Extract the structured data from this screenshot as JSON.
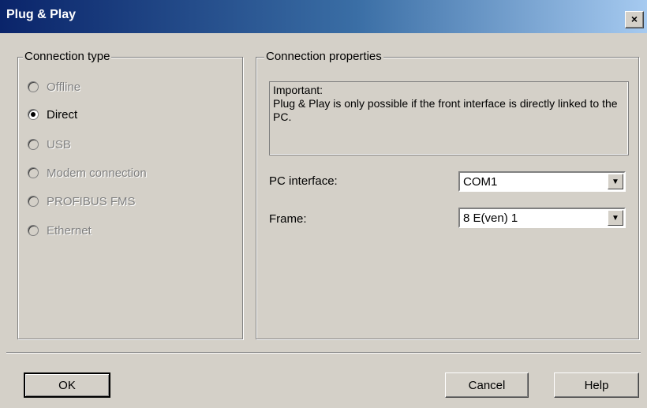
{
  "window": {
    "title": "Plug & Play",
    "close_glyph": "×"
  },
  "connection_type": {
    "legend": "Connection type",
    "options": [
      {
        "label": "Offline",
        "checked": false,
        "enabled": false
      },
      {
        "label": "Direct",
        "checked": true,
        "enabled": true
      },
      {
        "label": "USB",
        "checked": false,
        "enabled": false
      },
      {
        "label": "Modem connection",
        "checked": false,
        "enabled": false
      },
      {
        "label": "PROFIBUS FMS",
        "checked": false,
        "enabled": false
      },
      {
        "label": "Ethernet",
        "checked": false,
        "enabled": false
      }
    ]
  },
  "connection_properties": {
    "legend": "Connection properties",
    "info_line1": "Important:",
    "info_line2": "Plug & Play is only possible if the front interface is directly linked to the PC.",
    "pc_interface": {
      "label": "PC interface:",
      "value": "COM1"
    },
    "frame": {
      "label": "Frame:",
      "value": "8 E(ven) 1"
    }
  },
  "buttons": {
    "ok": "OK",
    "cancel": "Cancel",
    "help": "Help"
  },
  "colors": {
    "title_start": "#0a246a",
    "title_end": "#a6caf0",
    "face": "#d4d0c8",
    "disabled_text": "#808080"
  }
}
